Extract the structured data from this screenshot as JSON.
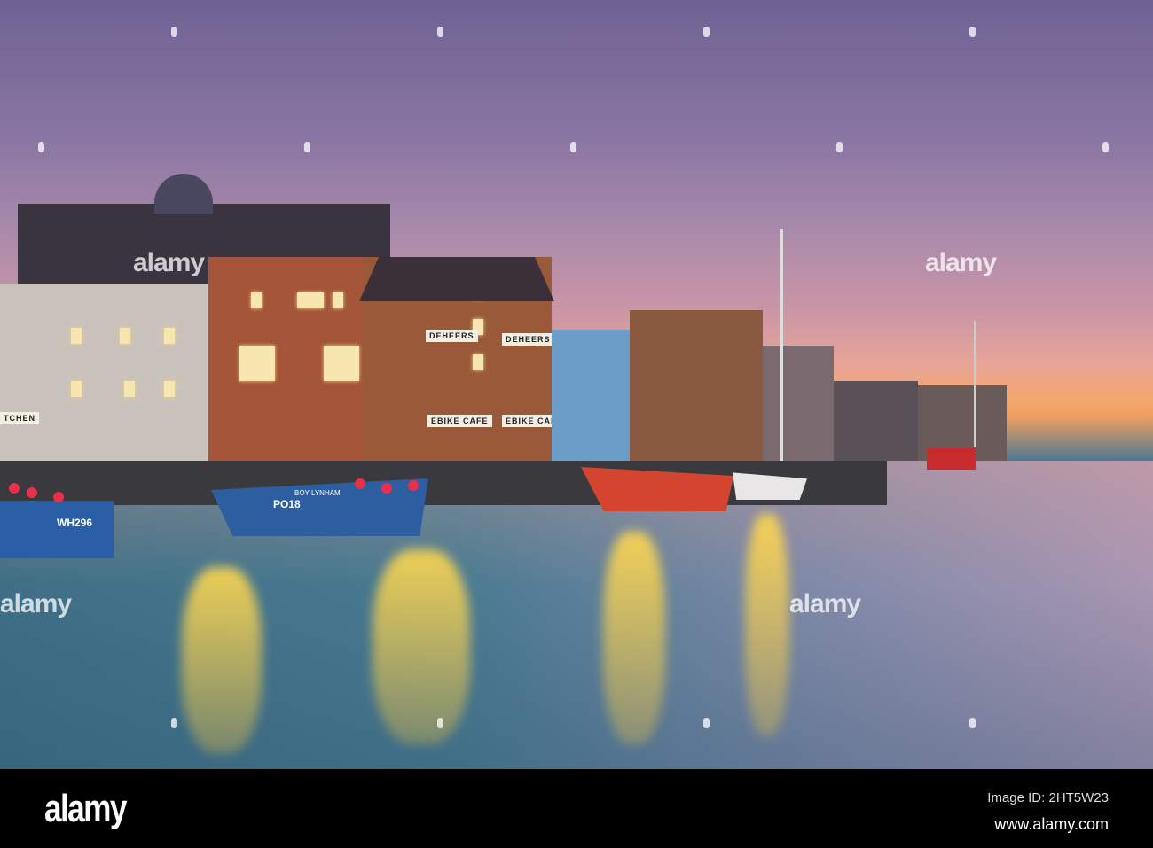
{
  "photo": {
    "description_free": true,
    "boats": {
      "left": "WH296",
      "center": "PO18",
      "center_name": "BOY LYNHAM"
    },
    "signs": [
      "DEHEERS",
      "DEHEERS",
      "EBIKE CAFE",
      "EBIKE CAFE",
      "TCHEN"
    ],
    "watermark": "alamy"
  },
  "footer": {
    "logo": "alamy",
    "image_id": "Image ID: 2HT5W23",
    "site": "www.alamy.com"
  },
  "colors": {
    "sky_top": "#6f6293",
    "horizon": "#f3a86e",
    "water": "#4a7b92",
    "bar": "#000000"
  }
}
